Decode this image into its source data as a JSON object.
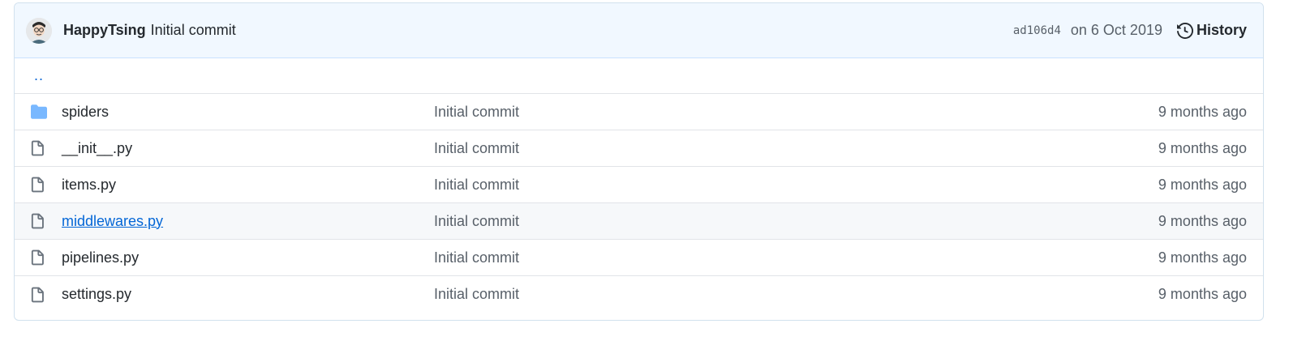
{
  "commit": {
    "author": "HappyTsing",
    "message": "Initial commit",
    "sha": "ad106d4",
    "date": "on 6 Oct 2019",
    "history_label": "History"
  },
  "up_label": "..",
  "colors": {
    "folder": "#79b8ff",
    "link": "#0366d6",
    "header_bg": "#f1f8ff"
  },
  "files": [
    {
      "type": "folder",
      "icon": "folder-icon",
      "name": "spiders",
      "message": "Initial commit",
      "age": "9 months ago"
    },
    {
      "type": "file",
      "icon": "file-icon",
      "name": "__init__.py",
      "message": "Initial commit",
      "age": "9 months ago"
    },
    {
      "type": "file",
      "icon": "file-icon",
      "name": "items.py",
      "message": "Initial commit",
      "age": "9 months ago"
    },
    {
      "type": "file",
      "icon": "file-icon",
      "name": "middlewares.py",
      "message": "Initial commit",
      "age": "9 months ago"
    },
    {
      "type": "file",
      "icon": "file-icon",
      "name": "pipelines.py",
      "message": "Initial commit",
      "age": "9 months ago"
    },
    {
      "type": "file",
      "icon": "file-icon",
      "name": "settings.py",
      "message": "Initial commit",
      "age": "9 months ago"
    }
  ]
}
